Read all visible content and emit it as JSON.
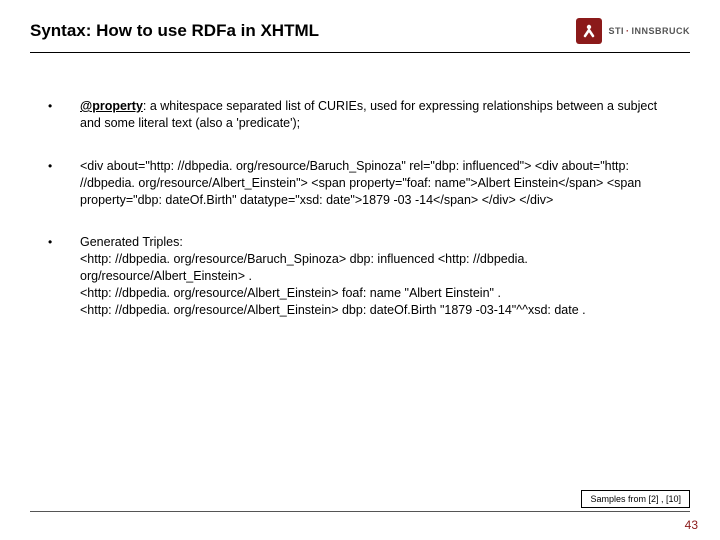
{
  "header": {
    "title": "Syntax: How to use RDFa in XHTML",
    "logo_brand": "STI",
    "logo_sep": "·",
    "logo_loc": "INNSBRUCK"
  },
  "bullets": {
    "b1_attr": "@property",
    "b1_rest": ": a whitespace separated list of CURIEs, used for expressing relationships between a subject and some literal text (also a 'predicate');",
    "b2": "<div about=\"http: //dbpedia. org/resource/Baruch_Spinoza\" rel=\"dbp: influenced\"> <div about=\"http: //dbpedia. org/resource/Albert_Einstein\"> <span property=\"foaf: name\">Albert Einstein</span> <span property=\"dbp: dateOf.Birth\" datatype=\"xsd: date\">1879 -03 -14</span> </div> </div>",
    "b3_head": "Generated Triples:",
    "b3_l1": " <http: //dbpedia. org/resource/Baruch_Spinoza> dbp: influenced <http: //dbpedia. org/resource/Albert_Einstein> .",
    "b3_l2": "<http: //dbpedia. org/resource/Albert_Einstein> foaf: name \"Albert Einstein\" .",
    "b3_l3": "<http: //dbpedia. org/resource/Albert_Einstein> dbp: dateOf.Birth \"1879 -03-14\"^^xsd: date ."
  },
  "footer": {
    "samples": "Samples from [2] , [10]",
    "page": "43"
  }
}
